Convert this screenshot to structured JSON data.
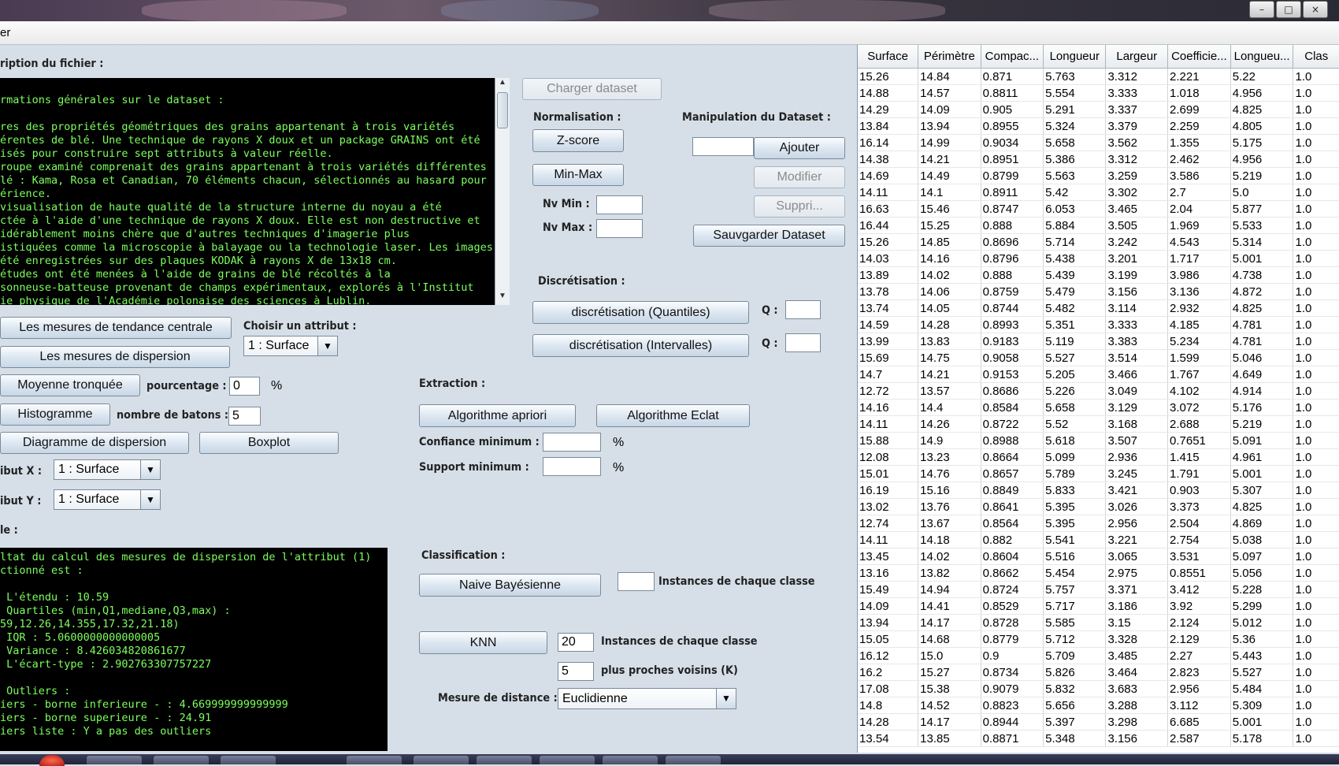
{
  "window": {
    "title": "er",
    "buttons": [
      "minimize",
      "maximize",
      "close"
    ]
  },
  "description": {
    "section_label": "ription du fichier :",
    "text": "rmations générales sur le dataset :\n\nres des propriétés géométriques des grains appartenant à trois variétés\nérentes de blé. Une technique de rayons X doux et un package GRAINS ont été\nisés pour construire sept attributs à valeur réelle.\nroupe examiné comprenait des grains appartenant à trois variétés différentes\nlé : Kama, Rosa et Canadian, 70 éléments chacun, sélectionnés au hasard pour\nérience.\nvisualisation de haute qualité de la structure interne du noyau a été\nctée à l'aide d'une technique de rayons X doux. Elle est non destructive et\nidérablement moins chère que d'autres techniques d'imagerie plus\nistiquées comme la microscopie à balayage ou la technologie laser. Les images\nété enregistrées sur des plaques KODAK à rayons X de 13x18 cm.\nétudes ont été menées à l'aide de grains de blé récoltés à la\nsonneuse-batteuse provenant de champs expérimentaux, explorés à l'Institut\nie physique de l'Académie polonaise des sciences à Lublin."
  },
  "stats": {
    "central_btn": "Les mesures de tendance centrale",
    "choose_attr_label": "Choisir un attribut :",
    "choose_attr_value": "1 : Surface",
    "dispersion_btn": "Les mesures de dispersion",
    "trimmed_btn": "Moyenne tronquée",
    "percent_label": "pourcentage :",
    "percent_value": "0",
    "percent_unit": "%",
    "hist_btn": "Histogramme",
    "bins_label": "nombre de batons :",
    "bins_value": "5",
    "scatter_btn": "Diagramme de dispersion",
    "boxplot_btn": "Boxplot",
    "attr_x_label": "ibut X :",
    "attr_x_value": "1 : Surface",
    "attr_y_label": "ibut Y :",
    "attr_y_value": "1 : Surface"
  },
  "console": {
    "label": "le :",
    "text": "ltat du calcul des mesures de dispersion de l'attribut (1)\nctionné est :\n\n L'étendu : 10.59\n Quartiles (min,Q1,mediane,Q3,max) :\n59,12.26,14.355,17.32,21.18)\n IQR : 5.0600000000000005\n Variance : 8.426034820861677\n L'écart-type : 2.902763307757227\n\n Outliers :\niers - borne inferieure - : 4.669999999999999\niers - borne superieure - : 24.91\niers liste : Y a pas des outliers"
  },
  "dataset": {
    "load_btn": "Charger dataset",
    "norm_label": "Normalisation :",
    "zscore_btn": "Z-score",
    "minmax_btn": "Min-Max",
    "nvmin_label": "Nv Min :",
    "nvmax_label": "Nv Max :",
    "manip_label": "Manipulation du Dataset :",
    "add_btn": "Ajouter",
    "modify_btn": "Modifier",
    "delete_btn": "Suppri...",
    "save_btn": "Sauvgarder Dataset",
    "discret_label": "Discrétisation :",
    "quantiles_btn": "discrétisation (Quantiles)",
    "intervals_btn": "discrétisation (Intervalles)",
    "q_label": "Q :"
  },
  "extraction": {
    "label": "Extraction :",
    "apriori_btn": "Algorithme apriori",
    "eclat_btn": "Algorithme Eclat",
    "confidence_label": "Confiance minimum :",
    "support_label": "Support minimum :",
    "unit": "%"
  },
  "classification": {
    "label": "Classification :",
    "bayes_btn": "Naive Bayésienne",
    "instances_label": "Instances de chaque classe",
    "knn_btn": "KNN",
    "knn_instances_value": "20",
    "knn_instances_label": "Instances de chaque classe",
    "k_value": "5",
    "k_label": "plus proches voisins (K)",
    "distance_label": "Mesure de distance :",
    "distance_value": "Euclidienne"
  },
  "table": {
    "columns": [
      "Surface",
      "Périmètre",
      "Compac...",
      "Longueur",
      "Largeur",
      "Coefficie...",
      "Longueu...",
      "Clas"
    ],
    "rows": [
      [
        "15.26",
        "14.84",
        "0.871",
        "5.763",
        "3.312",
        "2.221",
        "5.22",
        "1.0"
      ],
      [
        "14.88",
        "14.57",
        "0.8811",
        "5.554",
        "3.333",
        "1.018",
        "4.956",
        "1.0"
      ],
      [
        "14.29",
        "14.09",
        "0.905",
        "5.291",
        "3.337",
        "2.699",
        "4.825",
        "1.0"
      ],
      [
        "13.84",
        "13.94",
        "0.8955",
        "5.324",
        "3.379",
        "2.259",
        "4.805",
        "1.0"
      ],
      [
        "16.14",
        "14.99",
        "0.9034",
        "5.658",
        "3.562",
        "1.355",
        "5.175",
        "1.0"
      ],
      [
        "14.38",
        "14.21",
        "0.8951",
        "5.386",
        "3.312",
        "2.462",
        "4.956",
        "1.0"
      ],
      [
        "14.69",
        "14.49",
        "0.8799",
        "5.563",
        "3.259",
        "3.586",
        "5.219",
        "1.0"
      ],
      [
        "14.11",
        "14.1",
        "0.8911",
        "5.42",
        "3.302",
        "2.7",
        "5.0",
        "1.0"
      ],
      [
        "16.63",
        "15.46",
        "0.8747",
        "6.053",
        "3.465",
        "2.04",
        "5.877",
        "1.0"
      ],
      [
        "16.44",
        "15.25",
        "0.888",
        "5.884",
        "3.505",
        "1.969",
        "5.533",
        "1.0"
      ],
      [
        "15.26",
        "14.85",
        "0.8696",
        "5.714",
        "3.242",
        "4.543",
        "5.314",
        "1.0"
      ],
      [
        "14.03",
        "14.16",
        "0.8796",
        "5.438",
        "3.201",
        "1.717",
        "5.001",
        "1.0"
      ],
      [
        "13.89",
        "14.02",
        "0.888",
        "5.439",
        "3.199",
        "3.986",
        "4.738",
        "1.0"
      ],
      [
        "13.78",
        "14.06",
        "0.8759",
        "5.479",
        "3.156",
        "3.136",
        "4.872",
        "1.0"
      ],
      [
        "13.74",
        "14.05",
        "0.8744",
        "5.482",
        "3.114",
        "2.932",
        "4.825",
        "1.0"
      ],
      [
        "14.59",
        "14.28",
        "0.8993",
        "5.351",
        "3.333",
        "4.185",
        "4.781",
        "1.0"
      ],
      [
        "13.99",
        "13.83",
        "0.9183",
        "5.119",
        "3.383",
        "5.234",
        "4.781",
        "1.0"
      ],
      [
        "15.69",
        "14.75",
        "0.9058",
        "5.527",
        "3.514",
        "1.599",
        "5.046",
        "1.0"
      ],
      [
        "14.7",
        "14.21",
        "0.9153",
        "5.205",
        "3.466",
        "1.767",
        "4.649",
        "1.0"
      ],
      [
        "12.72",
        "13.57",
        "0.8686",
        "5.226",
        "3.049",
        "4.102",
        "4.914",
        "1.0"
      ],
      [
        "14.16",
        "14.4",
        "0.8584",
        "5.658",
        "3.129",
        "3.072",
        "5.176",
        "1.0"
      ],
      [
        "14.11",
        "14.26",
        "0.8722",
        "5.52",
        "3.168",
        "2.688",
        "5.219",
        "1.0"
      ],
      [
        "15.88",
        "14.9",
        "0.8988",
        "5.618",
        "3.507",
        "0.7651",
        "5.091",
        "1.0"
      ],
      [
        "12.08",
        "13.23",
        "0.8664",
        "5.099",
        "2.936",
        "1.415",
        "4.961",
        "1.0"
      ],
      [
        "15.01",
        "14.76",
        "0.8657",
        "5.789",
        "3.245",
        "1.791",
        "5.001",
        "1.0"
      ],
      [
        "16.19",
        "15.16",
        "0.8849",
        "5.833",
        "3.421",
        "0.903",
        "5.307",
        "1.0"
      ],
      [
        "13.02",
        "13.76",
        "0.8641",
        "5.395",
        "3.026",
        "3.373",
        "4.825",
        "1.0"
      ],
      [
        "12.74",
        "13.67",
        "0.8564",
        "5.395",
        "2.956",
        "2.504",
        "4.869",
        "1.0"
      ],
      [
        "14.11",
        "14.18",
        "0.882",
        "5.541",
        "3.221",
        "2.754",
        "5.038",
        "1.0"
      ],
      [
        "13.45",
        "14.02",
        "0.8604",
        "5.516",
        "3.065",
        "3.531",
        "5.097",
        "1.0"
      ],
      [
        "13.16",
        "13.82",
        "0.8662",
        "5.454",
        "2.975",
        "0.8551",
        "5.056",
        "1.0"
      ],
      [
        "15.49",
        "14.94",
        "0.8724",
        "5.757",
        "3.371",
        "3.412",
        "5.228",
        "1.0"
      ],
      [
        "14.09",
        "14.41",
        "0.8529",
        "5.717",
        "3.186",
        "3.92",
        "5.299",
        "1.0"
      ],
      [
        "13.94",
        "14.17",
        "0.8728",
        "5.585",
        "3.15",
        "2.124",
        "5.012",
        "1.0"
      ],
      [
        "15.05",
        "14.68",
        "0.8779",
        "5.712",
        "3.328",
        "2.129",
        "5.36",
        "1.0"
      ],
      [
        "16.12",
        "15.0",
        "0.9",
        "5.709",
        "3.485",
        "2.27",
        "5.443",
        "1.0"
      ],
      [
        "16.2",
        "15.27",
        "0.8734",
        "5.826",
        "3.464",
        "2.823",
        "5.527",
        "1.0"
      ],
      [
        "17.08",
        "15.38",
        "0.9079",
        "5.832",
        "3.683",
        "2.956",
        "5.484",
        "1.0"
      ],
      [
        "14.8",
        "14.52",
        "0.8823",
        "5.656",
        "3.288",
        "3.112",
        "5.309",
        "1.0"
      ],
      [
        "14.28",
        "14.17",
        "0.8944",
        "5.397",
        "3.298",
        "6.685",
        "5.001",
        "1.0"
      ],
      [
        "13.54",
        "13.85",
        "0.8871",
        "5.348",
        "3.156",
        "2.587",
        "5.178",
        "1.0"
      ]
    ]
  },
  "colors": {
    "panel": "#d6dfe8",
    "terminal_bg": "#000000",
    "terminal_fg": "#7dff5e"
  }
}
